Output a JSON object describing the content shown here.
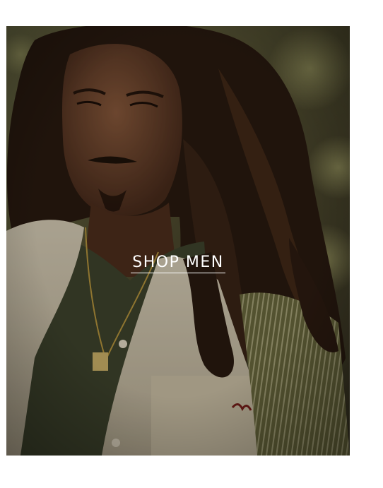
{
  "hero": {
    "cta_label": "SHOP MEN",
    "image_subject": "model-portrait",
    "colors": {
      "overlay": "#000000",
      "cta_text": "#ffffff",
      "page_background": "#ffffff"
    }
  }
}
